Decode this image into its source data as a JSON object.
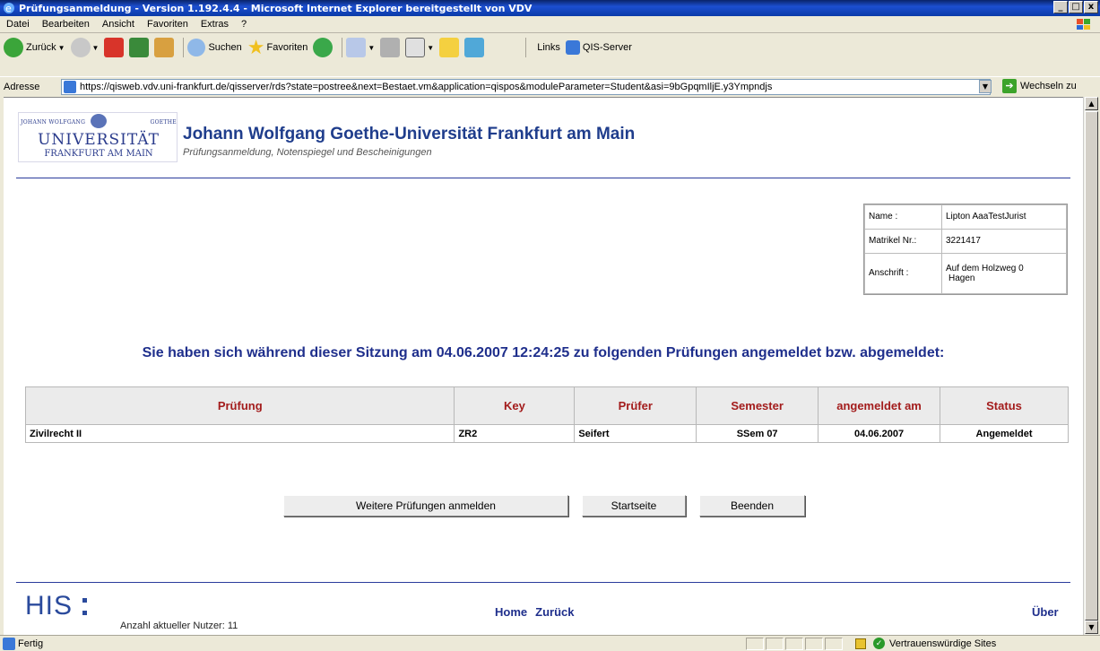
{
  "window": {
    "title": "Prüfungsanmeldung - Version 1.192.4.4 - Microsoft Internet Explorer bereitgestellt von VDV",
    "minimize": "_",
    "maximize": "□",
    "close": "x"
  },
  "menu": [
    "Datei",
    "Bearbeiten",
    "Ansicht",
    "Favoriten",
    "Extras",
    "?"
  ],
  "toolbar": {
    "back_label": "Zurück",
    "search_label": "Suchen",
    "favorites_label": "Favoriten",
    "links_label": "Links",
    "qis_link": "QIS-Server"
  },
  "address": {
    "label": "Adresse",
    "url": "https://qisweb.vdv.uni-frankfurt.de/qisserver/rds?state=postree&next=Bestaet.vm&application=qispos&moduleParameter=Student&asi=9bGpqmIljE.y3Ympndjs",
    "go_label": "Wechseln zu"
  },
  "header": {
    "logo_small_left": "JOHANN WOLFGANG",
    "logo_small_right": "GOETHE",
    "logo_uni": "UNIVERSITÄT",
    "logo_city": "FRANKFURT AM MAIN",
    "title": "Johann Wolfgang Goethe-Universität Frankfurt am Main",
    "subtitle": "Prüfungsanmeldung, Notenspiegel und Bescheinigungen"
  },
  "student": {
    "name_label": "Name :",
    "name_value": "Lipton AaaTestJurist",
    "matrikel_label": "Matrikel Nr.:",
    "matrikel_value": "3221417",
    "address_label": "Anschrift :",
    "address_line1": "Auf dem Holzweg 0",
    "address_line2": "Hagen"
  },
  "message": "Sie haben sich während dieser Sitzung am 04.06.2007 12:24:25 zu folgenden Prüfungen angemeldet bzw. abgemeldet:",
  "table": {
    "headers": [
      "Prüfung",
      "Key",
      "Prüfer",
      "Semester",
      "angemeldet am",
      "Status"
    ],
    "rows": [
      [
        "Zivilrecht II",
        "ZR2",
        "Seifert",
        "SSem 07",
        "04.06.2007",
        "Angemeldet"
      ]
    ]
  },
  "buttons": {
    "more": "Weitere Prüfungen anmelden",
    "start": "Startseite",
    "quit": "Beenden"
  },
  "footer": {
    "logo": "HIS",
    "users": "Anzahl aktueller Nutzer: 11",
    "home": "Home",
    "back": "Zurück",
    "about": "Über"
  },
  "status": {
    "text": "Fertig",
    "zone": "Vertrauenswürdige Sites"
  }
}
